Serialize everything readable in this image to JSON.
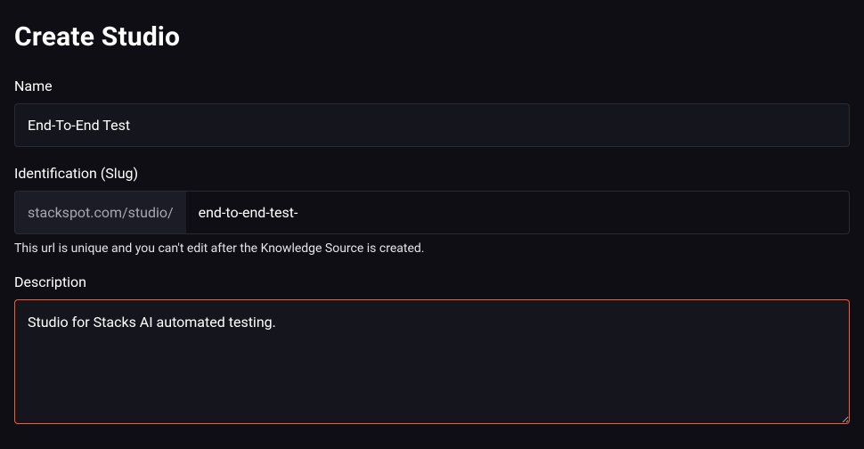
{
  "page": {
    "title": "Create Studio"
  },
  "form": {
    "name": {
      "label": "Name",
      "value": "End-To-End Test"
    },
    "slug": {
      "label": "Identification (Slug)",
      "prefix": "stackspot.com/studio/",
      "value": "end-to-end-test-",
      "helper": "This url is unique and you can't edit after the Knowledge Source is created."
    },
    "description": {
      "label": "Description",
      "value": "Studio for Stacks AI automated testing."
    }
  }
}
